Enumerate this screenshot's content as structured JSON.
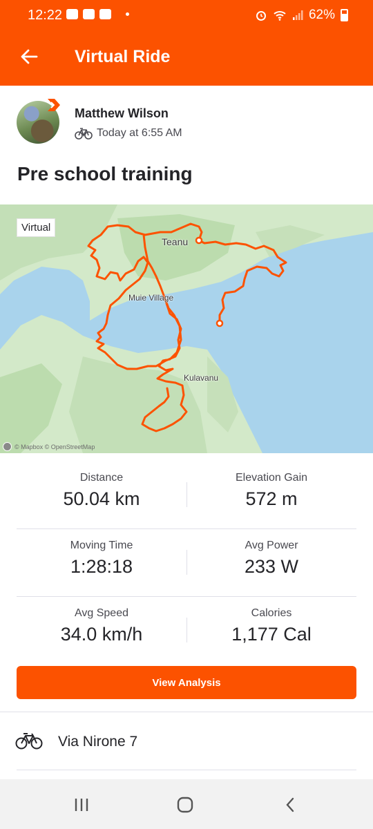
{
  "status_bar": {
    "time": "12:22",
    "battery": "62%"
  },
  "app_bar": {
    "title": "Virtual Ride"
  },
  "athlete": {
    "name": "Matthew Wilson",
    "timestamp": "Today at 6:55 AM",
    "activity_type_icon": "bike-icon"
  },
  "activity": {
    "title": "Pre school training"
  },
  "map": {
    "badge": "Virtual",
    "labels": {
      "teanu": "Teanu",
      "muie": "Muie Village",
      "kulavanu": "Kulavanu"
    },
    "attribution": "© Mapbox © OpenStreetMap"
  },
  "stats": {
    "distance": {
      "label": "Distance",
      "value": "50.04 km"
    },
    "elevation": {
      "label": "Elevation Gain",
      "value": "572 m"
    },
    "moving_time": {
      "label": "Moving Time",
      "value": "1:28:18"
    },
    "avg_power": {
      "label": "Avg Power",
      "value": "233 W"
    },
    "avg_speed": {
      "label": "Avg Speed",
      "value": "34.0 km/h"
    },
    "calories": {
      "label": "Calories",
      "value": "1,177 Cal"
    }
  },
  "analysis_button": {
    "label": "View Analysis"
  },
  "gear": {
    "name": "Via Nirone 7"
  },
  "colors": {
    "brand": "#fc5200",
    "route": "#fc5200",
    "water": "#a9d3ec",
    "land": "#cfe7c5"
  }
}
